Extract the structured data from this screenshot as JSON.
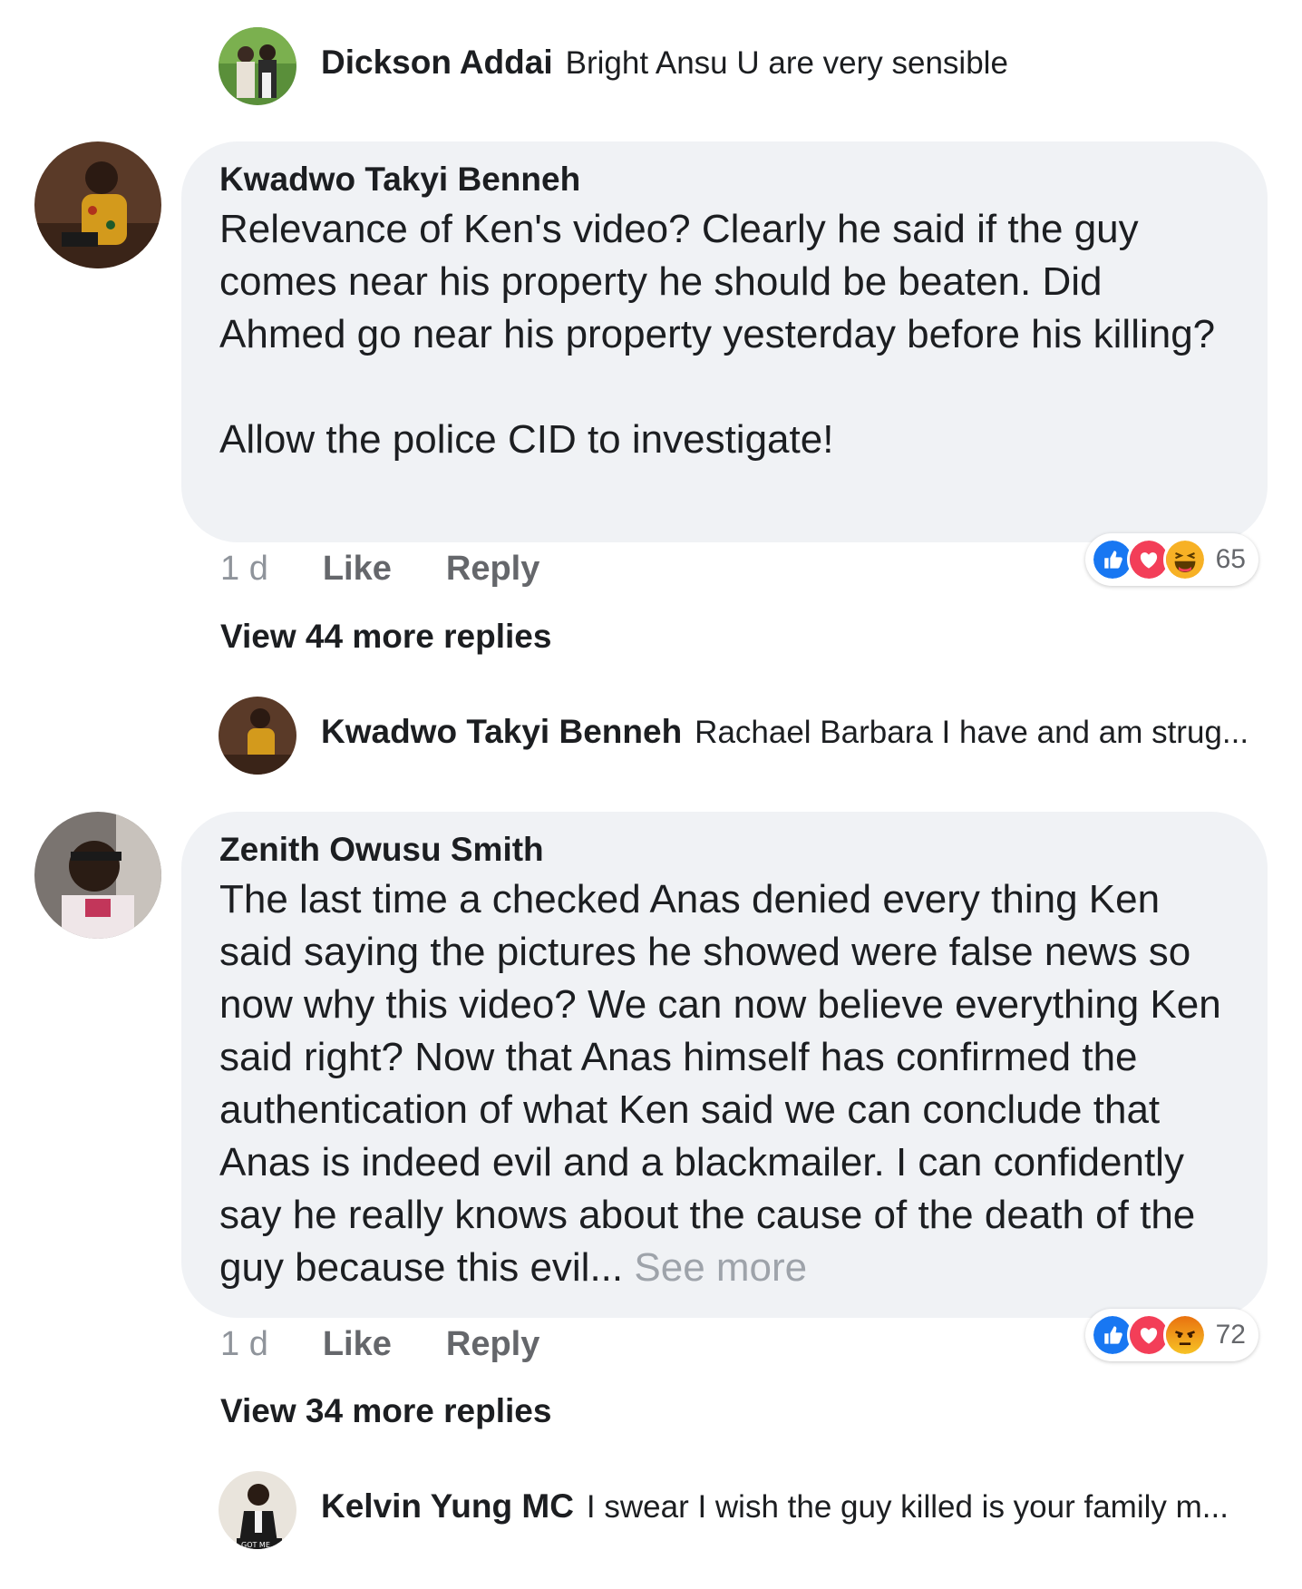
{
  "thread": [
    {
      "type": "reply-preview",
      "name": "Dickson Addai",
      "text": "Bright Ansu U are very sensible"
    },
    {
      "type": "comment",
      "name": "Kwadwo Takyi Benneh",
      "text": "Relevance of Ken's video? Clearly he said if the guy comes near his property he should be beaten.  Did Ahmed go near his property yesterday before his killing?\n\nAllow the police CID to investigate!",
      "time": "1 d",
      "like_label": "Like",
      "reply_label": "Reply",
      "reactions": [
        "like",
        "love",
        "haha"
      ],
      "reaction_count": "65",
      "view_more": "View 44 more replies"
    },
    {
      "type": "reply-preview",
      "name": "Kwadwo Takyi Benneh",
      "text": "Rachael Barbara I have and am strug..."
    },
    {
      "type": "comment",
      "name": "Zenith Owusu Smith",
      "text": "The last time a checked Anas denied every thing Ken said saying the pictures he showed were false news so now why this video? We can now believe everything Ken said right? Now that Anas himself has confirmed the authentication of what Ken said we can conclude that Anas is indeed evil and a blackmailer. I can confidently say he really knows about the cause of the death of the guy because this evil...",
      "see_more": "See more",
      "time": "1 d",
      "like_label": "Like",
      "reply_label": "Reply",
      "reactions": [
        "like",
        "love",
        "angry"
      ],
      "reaction_count": "72",
      "view_more": "View 34 more replies"
    },
    {
      "type": "reply-preview",
      "name": "Kelvin Yung MC",
      "text": "I swear I wish the guy killed is your family m...",
      "avatar_caption": "GOT ME"
    }
  ],
  "colors": {
    "bubble": "#f0f2f5",
    "like_blue": "#1877f2",
    "love_red": "#f33e58",
    "haha_yellow": "#f7b125",
    "angry_orange": "#e9710f"
  }
}
